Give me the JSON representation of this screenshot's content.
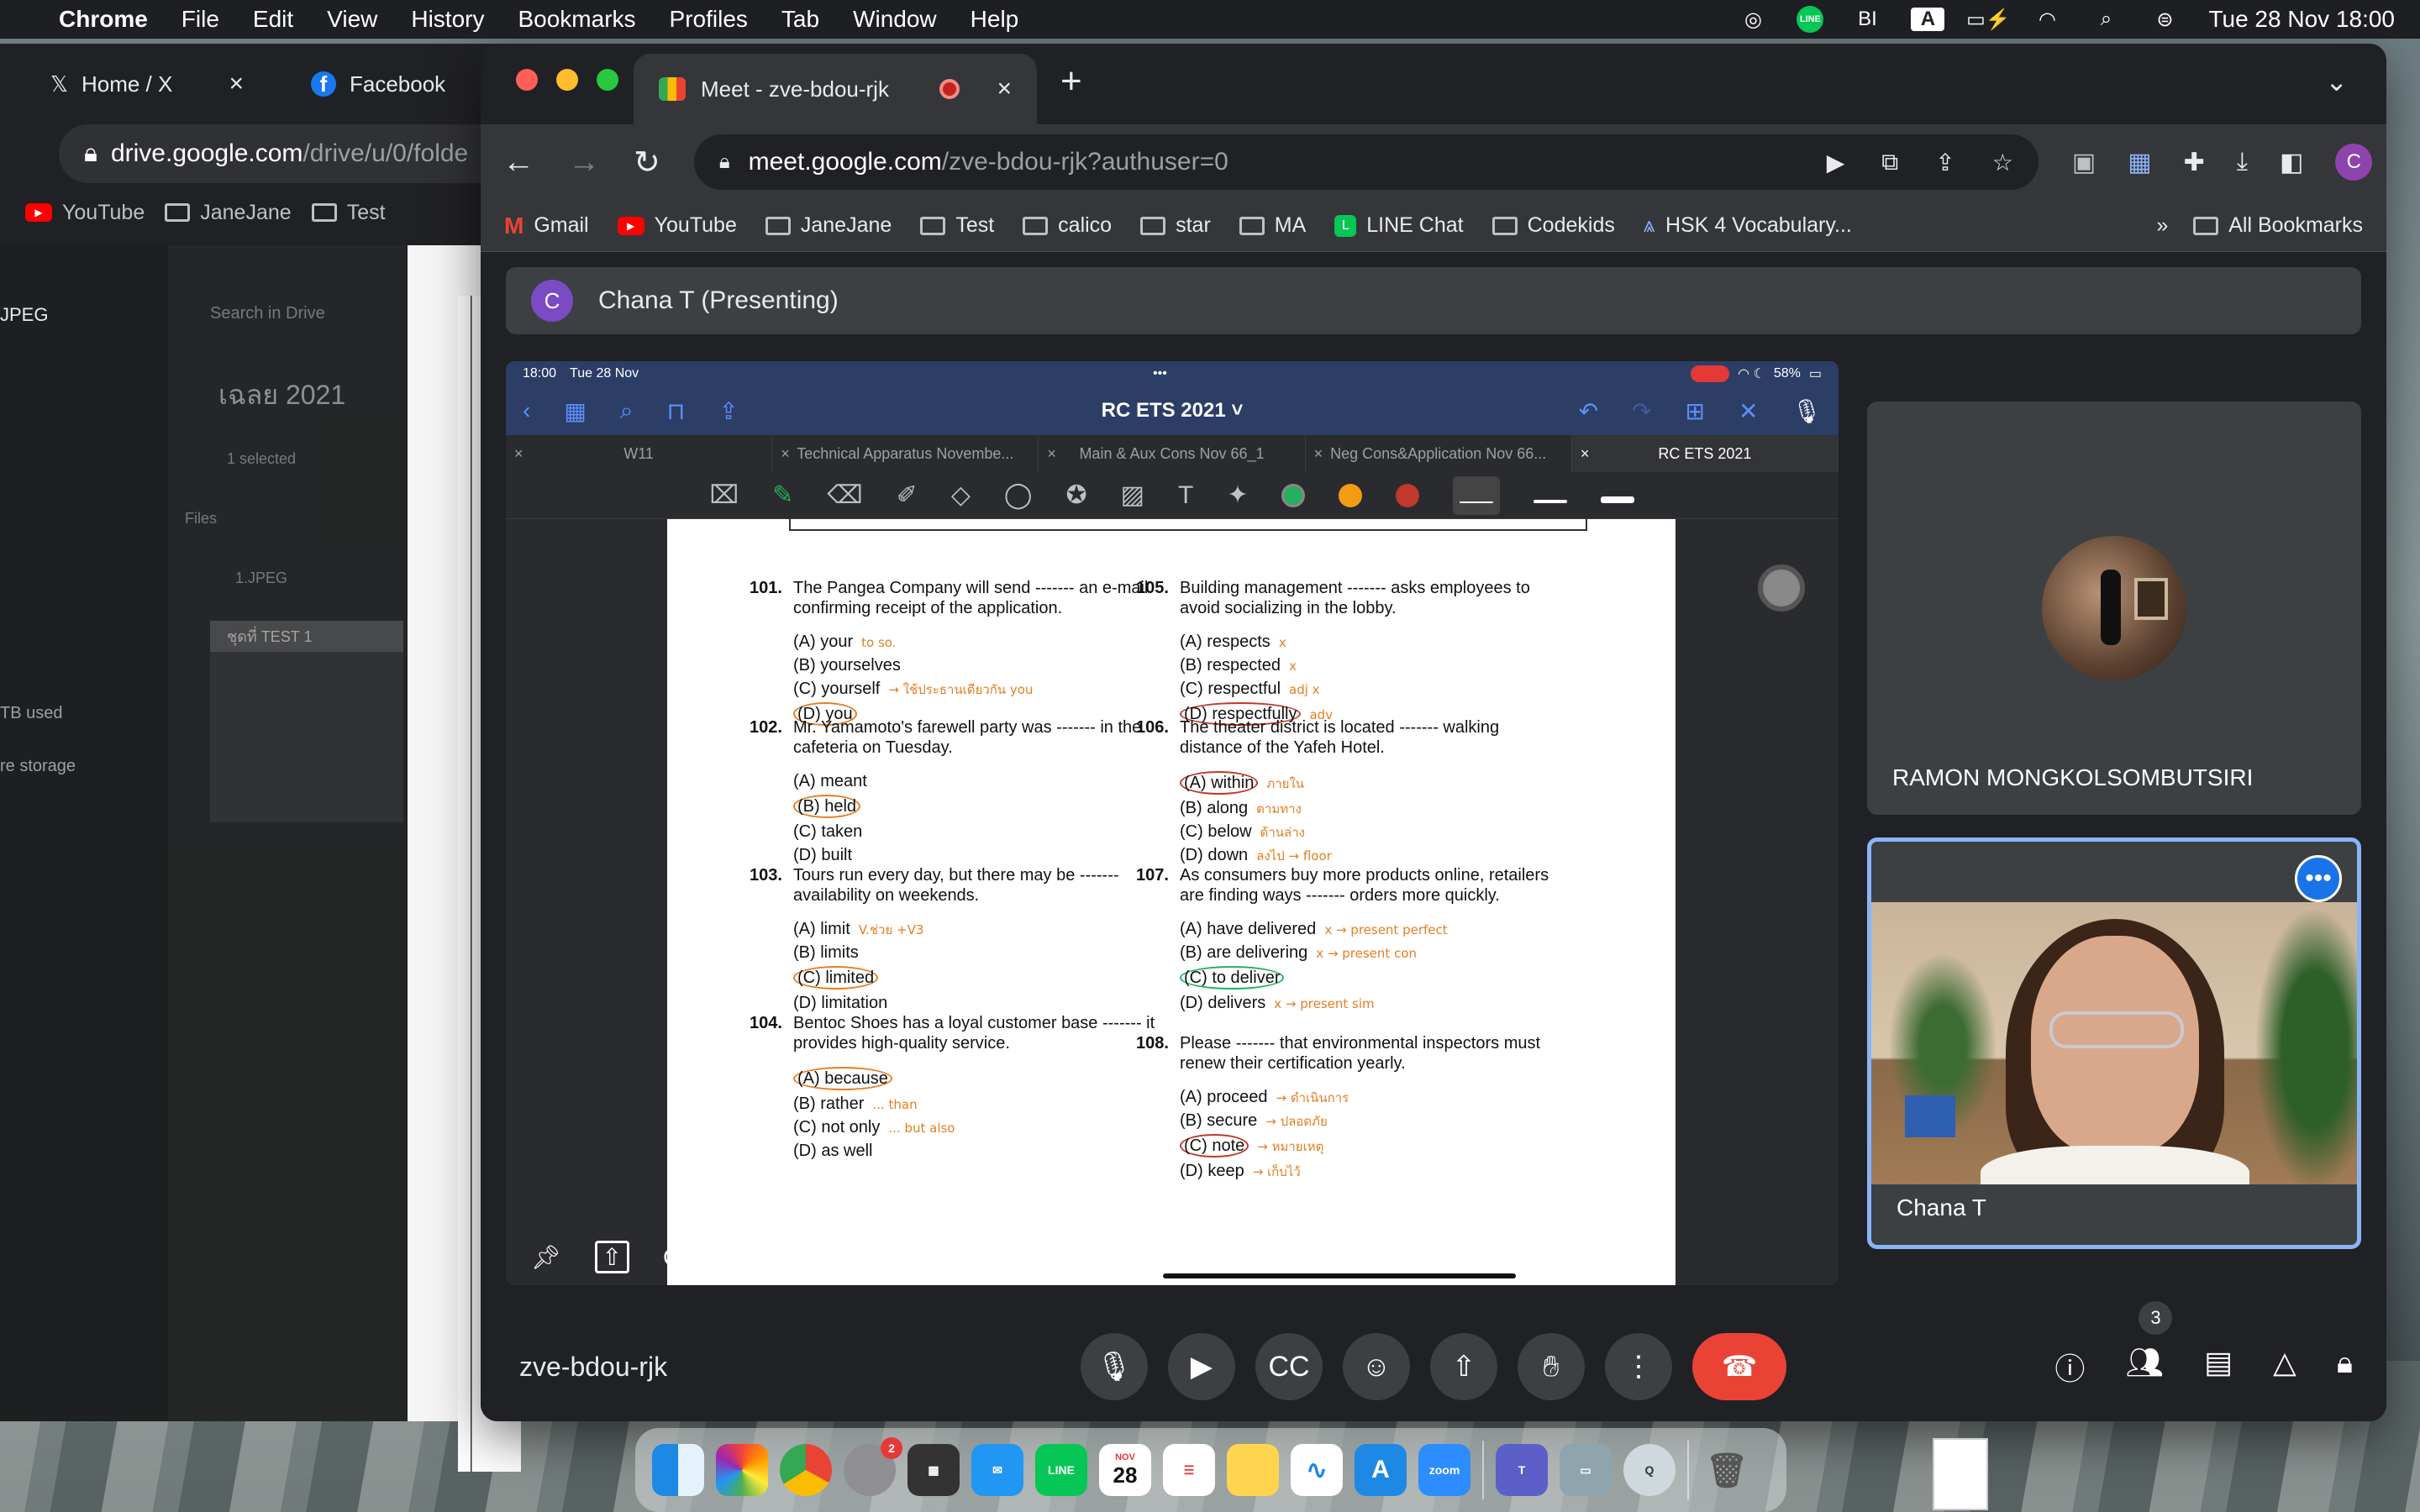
{
  "menubar": {
    "app": "Chrome",
    "items": [
      "File",
      "Edit",
      "View",
      "History",
      "Bookmarks",
      "Profiles",
      "Tab",
      "Window",
      "Help"
    ],
    "clock": "Tue 28 Nov  18:00",
    "input_source": "A"
  },
  "bg_window": {
    "tabs": [
      {
        "label": "Home / X",
        "icon": "x-logo-icon"
      },
      {
        "label": "Facebook",
        "icon": "facebook-icon"
      }
    ],
    "url_host": "drive.google.com",
    "url_path": "/drive/u/0/folde",
    "bookmarks": [
      "YouTube",
      "JaneJane",
      "Test"
    ],
    "side_items": [
      "JPEG",
      "Search in Drive",
      "เฉลย 2021",
      "1 selected",
      "Files",
      "1.JPEG",
      "ชุดที่ TEST 1",
      "TB used",
      "re storage"
    ]
  },
  "window": {
    "tab_title": "Meet - zve-bdou-rjk",
    "url_host": "meet.google.com",
    "url_path": "/zve-bdou-rjk?authuser=0",
    "profile_initial": "C",
    "bookmarks": [
      "Gmail",
      "YouTube",
      "JaneJane",
      "Test",
      "calico",
      "star",
      "MA",
      "LINE Chat",
      "Codekids",
      "HSK 4 Vocabulary..."
    ],
    "all_bookmarks": "All Bookmarks",
    "overflow": "»"
  },
  "meet": {
    "presenter_initial": "C",
    "presenting_label": "Chana T (Presenting)",
    "meeting_code": "zve-bdou-rjk",
    "participant_count": "3",
    "tiles": [
      {
        "name": "RAMON MONGKOLSOMBUTSIRI"
      },
      {
        "name": "Chana T"
      }
    ],
    "share_footer_name": "Chana T"
  },
  "ipad": {
    "time": "18:00",
    "date": "Tue 28 Nov",
    "battery": "58%",
    "doc_title": "RC ETS 2021 ˅",
    "tabs": [
      "W11",
      "Technical Apparatus Novembe...",
      "Main & Aux Cons Nov 66_1",
      "Neg Cons&Application Nov 66...",
      "RC ETS 2021"
    ]
  },
  "questions": [
    {
      "num": "101.",
      "stem": "The Pangea Company will send ------- an e-mail confirming receipt of the application.",
      "options": [
        "(A) your",
        "(B) yourselves",
        "(C) yourself",
        "(D) you"
      ],
      "notes": [
        "to so.",
        "",
        "→ ใช้ประธานเดียวกัน you",
        ""
      ],
      "marked": 3,
      "mark_color": "orange"
    },
    {
      "num": "102.",
      "stem": "Mr. Yamamoto's farewell party was ------- in the cafeteria on Tuesday.",
      "options": [
        "(A) meant",
        "(B) held",
        "(C) taken",
        "(D) built"
      ],
      "notes": [
        "",
        "",
        "",
        ""
      ],
      "marked": 1,
      "mark_color": "orange"
    },
    {
      "num": "103.",
      "stem": "Tours run every day, but there may be ------- availability on weekends.",
      "options": [
        "(A) limit",
        "(B) limits",
        "(C) limited",
        "(D) limitation"
      ],
      "notes": [
        "V.ช่วย  +V3",
        "",
        "",
        ""
      ],
      "marked": 2,
      "mark_color": "orange"
    },
    {
      "num": "104.",
      "stem": "Bentoc Shoes has a loyal customer base ------- it provides high-quality service.",
      "options": [
        "(A) because",
        "(B) rather",
        "(C) not only",
        "(D) as well"
      ],
      "notes": [
        "",
        "... than",
        "... but also",
        ""
      ],
      "marked": 0,
      "mark_color": "orange"
    },
    {
      "num": "105.",
      "stem": "Building management ------- asks employees to avoid socializing in the lobby.",
      "options": [
        "(A) respects",
        "(B) respected",
        "(C) respectful",
        "(D) respectfully"
      ],
      "notes": [
        "x",
        "x",
        "adj x",
        "adv"
      ],
      "marked": 3,
      "mark_color": "red"
    },
    {
      "num": "106.",
      "stem": "The theater district is located ------- walking distance of the Yafeh Hotel.",
      "options": [
        "(A) within",
        "(B) along",
        "(C) below",
        "(D) down"
      ],
      "notes": [
        "ภายใน",
        "ตามทาง",
        "ด้านล่าง",
        "ลงไป  → floor"
      ],
      "marked": 0,
      "mark_color": "red"
    },
    {
      "num": "107.",
      "stem": "As consumers buy more products online, retailers are finding ways ------- orders more quickly.",
      "options": [
        "(A) have delivered",
        "(B) are delivering",
        "(C) to deliver",
        "(D) delivers"
      ],
      "notes": [
        "x → present perfect",
        "x → present con",
        "",
        "x → present sim"
      ],
      "marked": 2,
      "mark_color": "green"
    },
    {
      "num": "108.",
      "stem": "Please ------- that environmental inspectors must renew their certification yearly.",
      "options": [
        "(A) proceed",
        "(B) secure",
        "(C) note",
        "(D) keep"
      ],
      "notes": [
        "→ ดำเนินการ",
        "→ ปลอดภัย",
        "→ หมายเหตุ",
        "→ เก็บไว้"
      ],
      "marked": 2,
      "mark_color": "red"
    }
  ],
  "dock": {
    "calendar_month": "NOV",
    "calendar_day": "28",
    "settings_badge": "2",
    "zoom_label": "zoom"
  }
}
